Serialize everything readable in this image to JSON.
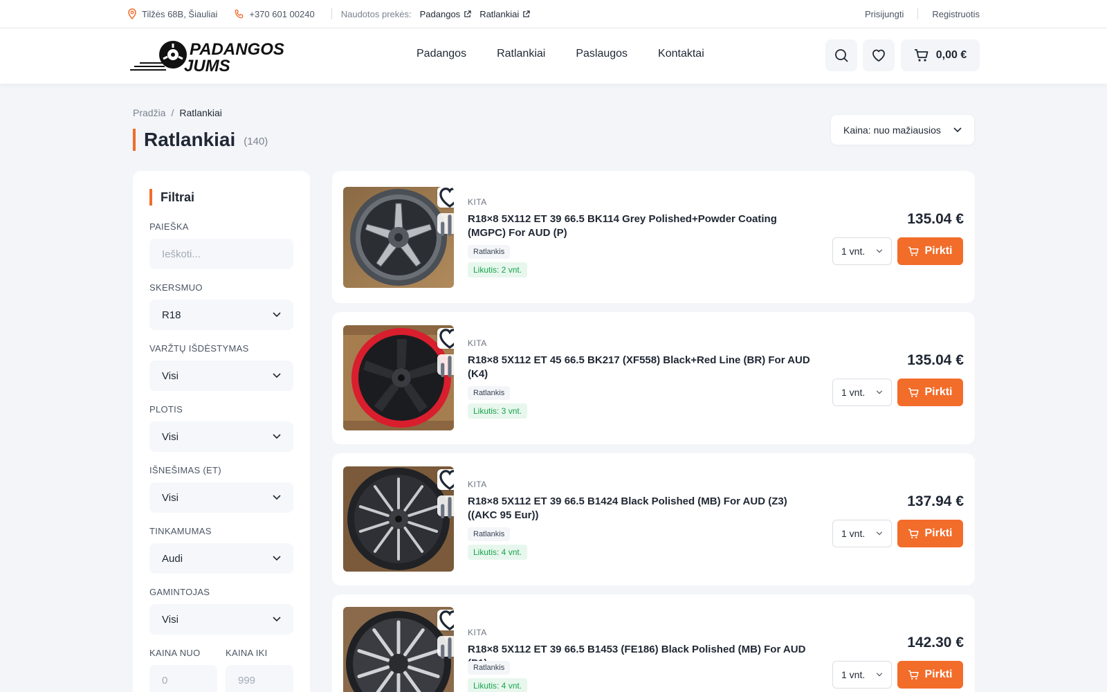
{
  "topbar": {
    "address": "Tilžės 68B, Šiauliai",
    "phone": "+370 601 00240",
    "used_label": "Naudotos prekės:",
    "used_links": [
      "Padangos",
      "Ratlankiai"
    ],
    "login": "Prisijungti",
    "register": "Registruotis"
  },
  "header": {
    "logo_line1": "PADANGOS",
    "logo_line2": "JUMS",
    "nav": [
      "Padangos",
      "Ratlankiai",
      "Paslaugos",
      "Kontaktai"
    ],
    "cart_total": "0,00 €"
  },
  "breadcrumb": {
    "home": "Pradžia",
    "sep": "/",
    "current": "Ratlankiai"
  },
  "page": {
    "title": "Ratlankiai",
    "count": "(140)"
  },
  "sort": {
    "selected": "Kaina: nuo mažiausios"
  },
  "filters": {
    "title": "Filtrai",
    "search_label": "PAIEŠKA",
    "search_placeholder": "Ieškoti...",
    "diameter_label": "SKERSMUO",
    "diameter_value": "R18",
    "bolt_label": "VARŽTŲ IŠDĖSTYMAS",
    "bolt_value": "Visi",
    "width_label": "PLOTIS",
    "width_value": "Visi",
    "et_label": "IŠNEŠIMAS (ET)",
    "et_value": "Visi",
    "fit_label": "TINKAMUMAS",
    "fit_value": "Audi",
    "maker_label": "GAMINTOJAS",
    "maker_value": "Visi",
    "price_from_label": "KAINA NUO",
    "price_from_placeholder": "0",
    "price_to_label": "KAINA IKI",
    "price_to_placeholder": "999"
  },
  "products": [
    {
      "brand": "KITA",
      "name": "R18×8 5X112 ET 39 66.5 BK114 Grey Polished+Powder Coating (MGPC) For AUD (P)",
      "type": "Ratlankis",
      "stock": "Likutis: 2 vnt.",
      "price": "135.04 €",
      "qty": "1 vnt.",
      "buy": "Pirkti"
    },
    {
      "brand": "KITA",
      "name": "R18×8 5X112 ET 45 66.5 BK217 (XF558) Black+Red Line (BR) For AUD (K4)",
      "type": "Ratlankis",
      "stock": "Likutis: 3 vnt.",
      "price": "135.04 €",
      "qty": "1 vnt.",
      "buy": "Pirkti"
    },
    {
      "brand": "KITA",
      "name": "R18×8 5X112 ET 39 66.5 B1424 Black Polished (MB) For AUD (Z3) ((AKC 95 Eur))",
      "type": "Ratlankis",
      "stock": "Likutis: 4 vnt.",
      "price": "137.94 €",
      "qty": "1 vnt.",
      "buy": "Pirkti"
    },
    {
      "brand": "KITA",
      "name": "R18×8 5X112 ET 39 66.5 B1453 (FE186) Black Polished (MB) For AUD (P1)",
      "type": "Ratlankis",
      "stock": "Likutis: 4 vnt.",
      "price": "142.30 €",
      "qty": "1 vnt.",
      "buy": "Pirkti"
    }
  ],
  "colors": {
    "accent": "#f26c2a",
    "stock_green": "#16a34a",
    "page_bg": "#f3f5f9"
  }
}
